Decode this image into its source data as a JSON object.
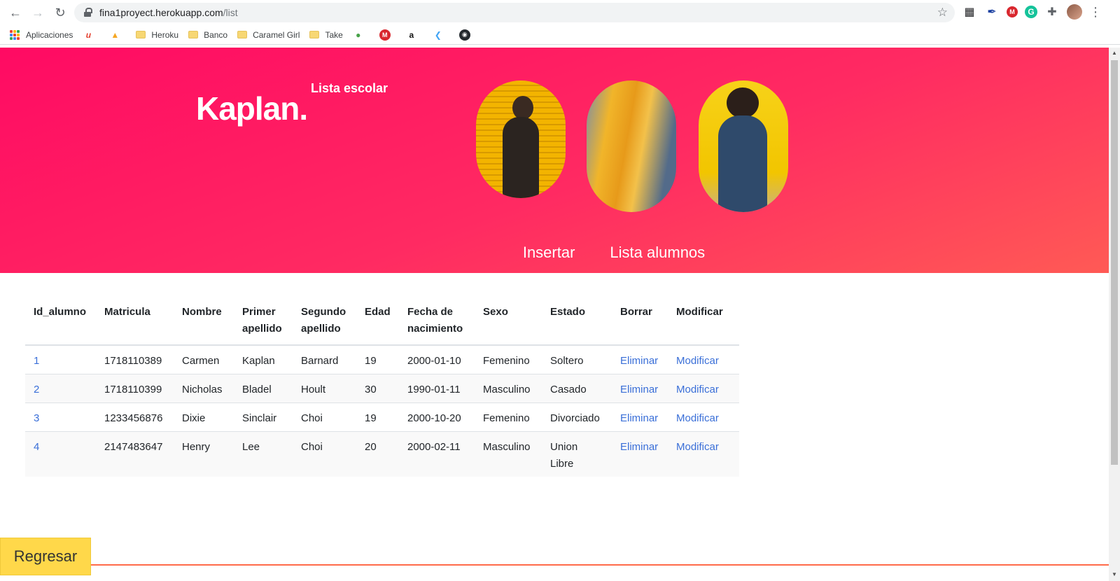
{
  "browser": {
    "url_host": "fina1proyect.herokuapp.com",
    "url_path": "/list",
    "bookmarks": [
      {
        "label": "Aplicaciones",
        "icon": "apps-grid-icon"
      },
      {
        "label": "",
        "icon": "todoist-icon"
      },
      {
        "label": "",
        "icon": "firebase-icon"
      },
      {
        "label": "Heroku",
        "icon": "folder-icon"
      },
      {
        "label": "Banco",
        "icon": "folder-icon"
      },
      {
        "label": "Caramel Girl",
        "icon": "folder-icon"
      },
      {
        "label": "Take",
        "icon": "folder-icon"
      },
      {
        "label": "",
        "icon": "mongodb-icon"
      },
      {
        "label": "",
        "icon": "mega-icon"
      },
      {
        "label": "",
        "icon": "amazon-icon"
      },
      {
        "label": "",
        "icon": "flutter-icon"
      },
      {
        "label": "",
        "icon": "github-icon"
      }
    ]
  },
  "hero": {
    "brand": "Kaplan.",
    "tagline": "Lista escolar",
    "nav": [
      "Insertar",
      "Lista alumnos"
    ]
  },
  "table": {
    "headers": [
      "Id_alumno",
      "Matricula",
      "Nombre",
      "Primer apellido",
      "Segundo apellido",
      "Edad",
      "Fecha de nacimiento",
      "Sexo",
      "Estado",
      "Borrar",
      "Modificar"
    ],
    "rows": [
      {
        "id": "1",
        "matricula": "1718110389",
        "nombre": "Carmen",
        "primer": "Kaplan",
        "segundo": "Barnard",
        "edad": "19",
        "fecha": "2000-01-10",
        "sexo": "Femenino",
        "estado": "Soltero",
        "borrar": "Eliminar",
        "modificar": "Modificar"
      },
      {
        "id": "2",
        "matricula": "1718110399",
        "nombre": "Nicholas",
        "primer": "Bladel",
        "segundo": "Hoult",
        "edad": "30",
        "fecha": "1990-01-11",
        "sexo": "Masculino",
        "estado": "Casado",
        "borrar": "Eliminar",
        "modificar": "Modificar"
      },
      {
        "id": "3",
        "matricula": "1233456876",
        "nombre": "Dixie",
        "primer": "Sinclair",
        "segundo": "Choi",
        "edad": "19",
        "fecha": "2000-10-20",
        "sexo": "Femenino",
        "estado": "Divorciado",
        "borrar": "Eliminar",
        "modificar": "Modificar"
      },
      {
        "id": "4",
        "matricula": "2147483647",
        "nombre": "Henry",
        "primer": "Lee",
        "segundo": "Choi",
        "edad": "20",
        "fecha": "2000-02-11",
        "sexo": "Masculino",
        "estado": "Union Libre",
        "borrar": "Eliminar",
        "modificar": "Modificar"
      }
    ]
  },
  "back_button": "Regresar",
  "colors": {
    "hero_start": "#ff0a63",
    "hero_end": "#ff5a55",
    "link": "#3a6fd8",
    "back_button": "#ffd84a"
  }
}
